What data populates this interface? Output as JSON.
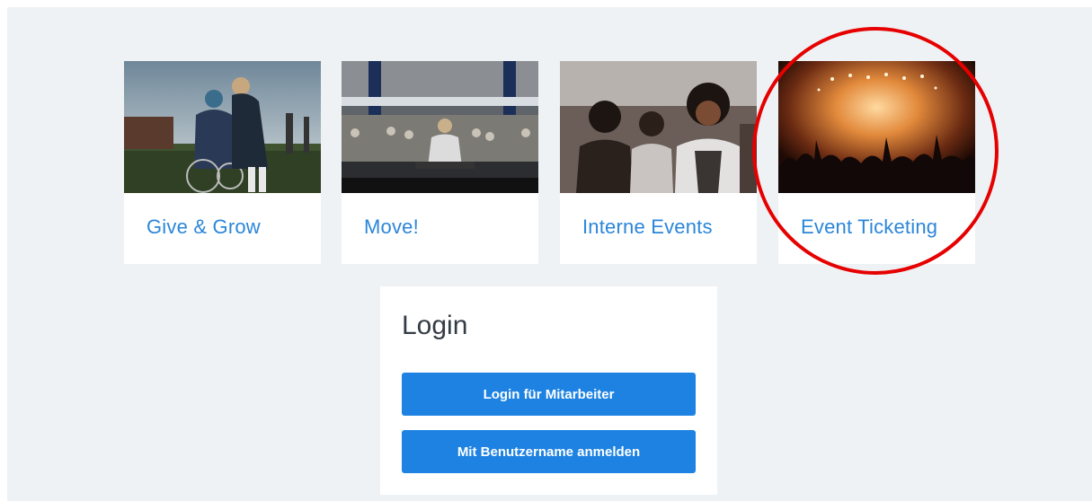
{
  "cards": [
    {
      "label": "Give & Grow",
      "image": "photo-volunteer-wheelchair"
    },
    {
      "label": "Move!",
      "image": "photo-fitness-class"
    },
    {
      "label": "Interne Events",
      "image": "photo-audience-women"
    },
    {
      "label": "Event Ticketing",
      "image": "photo-concert-crowd"
    }
  ],
  "login": {
    "title": "Login",
    "employee_button": "Login für Mitarbeiter",
    "username_button": "Mit Benutzername anmelden"
  },
  "colors": {
    "panel_bg": "#eef2f4",
    "link": "#2b86d9",
    "button": "#1d82e2",
    "highlight": "#e60000"
  }
}
